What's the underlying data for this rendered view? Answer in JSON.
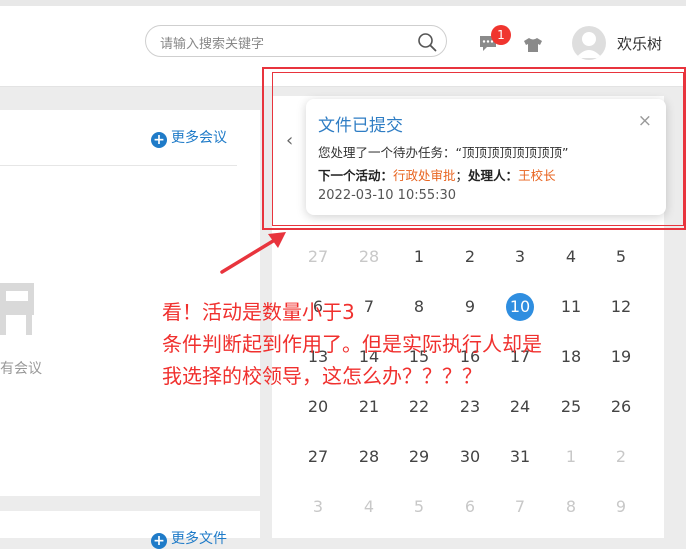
{
  "header": {
    "search_placeholder": "请输入搜索关键字",
    "chat_badge": "1",
    "username": "欢乐树"
  },
  "left_panel": {
    "more_meetings": "更多会议",
    "empty_text": "有会议",
    "more_files": "更多文件"
  },
  "calendar": {
    "prev": "‹",
    "today": "10",
    "rows": [
      [
        {
          "d": "27",
          "m": true
        },
        {
          "d": "28",
          "m": true
        },
        {
          "d": "1",
          "m": false
        },
        {
          "d": "2",
          "m": false
        },
        {
          "d": "3",
          "m": false
        },
        {
          "d": "4",
          "m": false
        },
        {
          "d": "5",
          "m": false
        }
      ],
      [
        {
          "d": "6",
          "m": false
        },
        {
          "d": "7",
          "m": false
        },
        {
          "d": "8",
          "m": false
        },
        {
          "d": "9",
          "m": false
        },
        {
          "d": "10",
          "m": false,
          "t": true
        },
        {
          "d": "11",
          "m": false
        },
        {
          "d": "12",
          "m": false
        }
      ],
      [
        {
          "d": "13",
          "m": false
        },
        {
          "d": "14",
          "m": false
        },
        {
          "d": "15",
          "m": false
        },
        {
          "d": "16",
          "m": false
        },
        {
          "d": "17",
          "m": false
        },
        {
          "d": "18",
          "m": false
        },
        {
          "d": "19",
          "m": false
        }
      ],
      [
        {
          "d": "20",
          "m": false
        },
        {
          "d": "21",
          "m": false
        },
        {
          "d": "22",
          "m": false
        },
        {
          "d": "23",
          "m": false
        },
        {
          "d": "24",
          "m": false
        },
        {
          "d": "25",
          "m": false
        },
        {
          "d": "26",
          "m": false
        }
      ],
      [
        {
          "d": "27",
          "m": false
        },
        {
          "d": "28",
          "m": false
        },
        {
          "d": "29",
          "m": false
        },
        {
          "d": "30",
          "m": false
        },
        {
          "d": "31",
          "m": false
        },
        {
          "d": "1",
          "m": true
        },
        {
          "d": "2",
          "m": true
        }
      ],
      [
        {
          "d": "3",
          "m": true
        },
        {
          "d": "4",
          "m": true
        },
        {
          "d": "5",
          "m": true
        },
        {
          "d": "6",
          "m": true
        },
        {
          "d": "7",
          "m": true
        },
        {
          "d": "8",
          "m": true
        },
        {
          "d": "9",
          "m": true
        }
      ]
    ]
  },
  "notification": {
    "title": "文件已提交",
    "close": "×",
    "line1_prefix": "您处理了一个待办任务：",
    "line1_task": "“顶顶顶顶顶顶顶顶”",
    "next_activity_label": "下一个活动：",
    "next_activity_value": "行政处审批",
    "separator": "；",
    "handler_label": "处理人：",
    "handler_value": "王校长",
    "time": "2022-03-10 10:55:30"
  },
  "annotation": {
    "line1": "看！活动是数量小于3",
    "line2": "条件判断起到作用了。但是实际执行人却是",
    "line3": "我选择的校领导，这怎么办？？？？"
  },
  "colors": {
    "accent": "#2f7dc4",
    "highlight": "#e86420",
    "annotation": "#f0302e",
    "badge": "#f0352f"
  }
}
